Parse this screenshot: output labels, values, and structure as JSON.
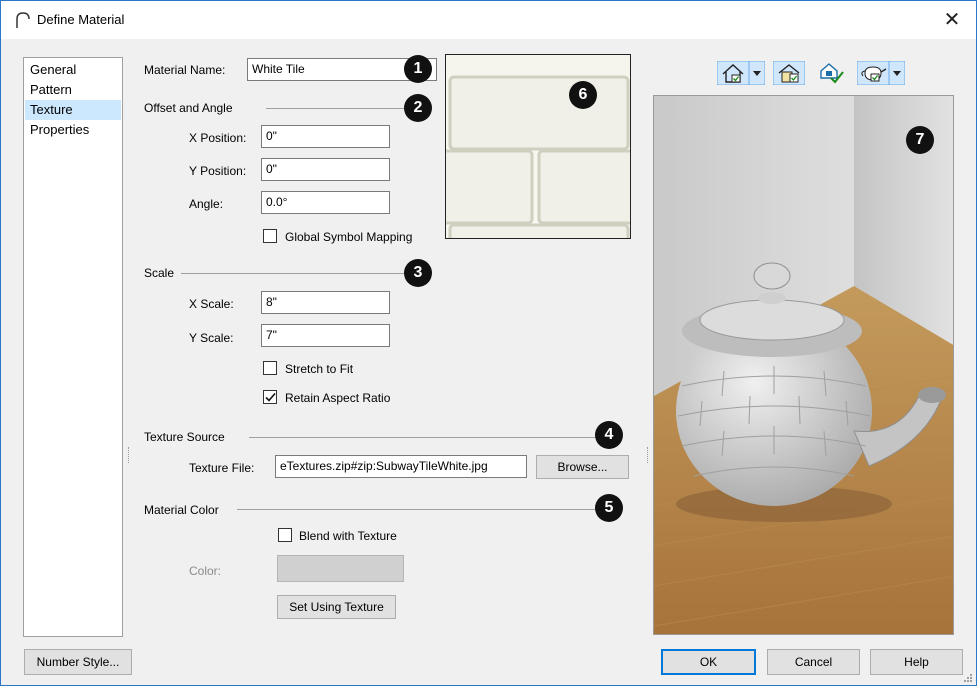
{
  "window": {
    "title": "Define Material",
    "close_glyph": "✕"
  },
  "nav": {
    "items": [
      "General",
      "Pattern",
      "Texture",
      "Properties"
    ],
    "selected": "Texture"
  },
  "material_name": {
    "label": "Material Name:",
    "value": "White Tile"
  },
  "offset_angle": {
    "header": "Offset and Angle",
    "x_label": "X Position:",
    "x_value": "0\"",
    "y_label": "Y Position:",
    "y_value": "0\"",
    "angle_label": "Angle:",
    "angle_value": "0.0°",
    "global_mapping_label": "Global Symbol Mapping",
    "global_mapping_checked": false
  },
  "scale": {
    "header": "Scale",
    "x_label": "X Scale:",
    "x_value": "8\"",
    "y_label": "Y Scale:",
    "y_value": "7\"",
    "stretch_label": "Stretch to Fit",
    "stretch_checked": false,
    "aspect_label": "Retain Aspect Ratio",
    "aspect_checked": true
  },
  "texture_source": {
    "header": "Texture Source",
    "file_label": "Texture File:",
    "file_value": "eTextures.zip#zip:SubwayTileWhite.jpg",
    "browse_label": "Browse..."
  },
  "material_color": {
    "header": "Material Color",
    "blend_label": "Blend with Texture",
    "blend_checked": false,
    "color_label": "Color:",
    "swatch_color": "#d0d0d0",
    "set_texture_label": "Set Using Texture"
  },
  "badges": [
    "1",
    "2",
    "3",
    "4",
    "5",
    "6",
    "7"
  ],
  "toolbar": {
    "icons": [
      "house-view-icon",
      "dropdown-arrow-icon",
      "page-view-icon",
      "house-check-icon",
      "teapot-view-icon",
      "dropdown-arrow-icon"
    ]
  },
  "footer": {
    "number_style_label": "Number Style...",
    "ok_label": "OK",
    "cancel_label": "Cancel",
    "help_label": "Help"
  },
  "colors": {
    "accent": "#0078d7",
    "selection": "#cce8ff",
    "badge": "#111111"
  }
}
